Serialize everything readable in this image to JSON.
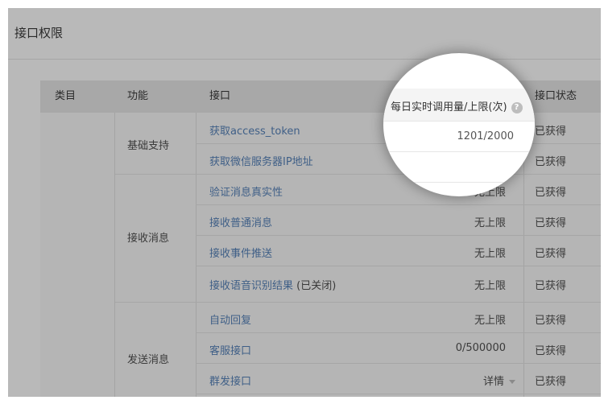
{
  "page": {
    "title": "接口权限"
  },
  "table": {
    "columns": {
      "category": "类目",
      "function": "功能",
      "api": "接口",
      "quota": "每日实时调用量/上限(次)",
      "status": "接口状态"
    },
    "groups": {
      "basic": "基础支持",
      "receive": "接收消息",
      "send": "发送消息"
    },
    "rows": [
      {
        "api": "获取access_token",
        "quota": "1201/2000",
        "status": "已获得"
      },
      {
        "api": "获取微信服务器IP地址",
        "quota": "",
        "status": "已获得"
      },
      {
        "api": "验证消息真实性",
        "quota": "无上限",
        "status": "已获得"
      },
      {
        "api": "接收普通消息",
        "quota": "无上限",
        "status": "已获得"
      },
      {
        "api": "接收事件推送",
        "quota": "无上限",
        "status": "已获得"
      },
      {
        "api": "接收语音识别结果",
        "note": " (已关闭)",
        "quota": "无上限",
        "status": "已获得"
      },
      {
        "api": "自动回复",
        "quota": "无上限",
        "status": "已获得"
      },
      {
        "api": "客服接口",
        "quota": "0/500000",
        "status": "已获得"
      },
      {
        "api": "群发接口",
        "quota": "详情",
        "status": "已获得"
      }
    ]
  },
  "icons": {
    "help": "help-circle-icon",
    "dropdown": "caret-down-icon"
  }
}
